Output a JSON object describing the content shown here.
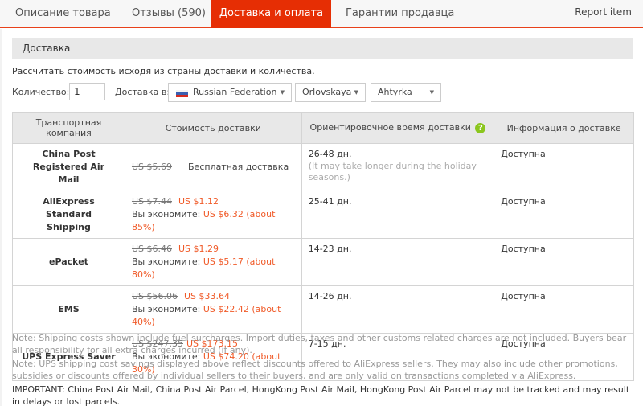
{
  "tabs": [
    {
      "label": "Описание товара",
      "active": false
    },
    {
      "label": "Отзывы (590)",
      "active": false
    },
    {
      "label": "Доставка и оплата",
      "active": true
    },
    {
      "label": "Гарантии продавца",
      "active": false
    }
  ],
  "report_link": "Report item",
  "section_title": "Доставка",
  "calc_text": "Рассчитать стоимость исходя из страны доставки и количества.",
  "form": {
    "quantity_label": "Количество:",
    "quantity_value": "1",
    "ship_to_label": "Доставка в:",
    "country": "Russian Federation",
    "region": "Orlovskaya",
    "city": "Ahtyrka"
  },
  "colors": {
    "accent": "#e62e04",
    "price": "#f05a28",
    "help": "#8bc61e"
  },
  "table": {
    "headers": [
      "Транспортная компания",
      "Стоимость доставки",
      "Ориентировочное время доставки",
      "Информация о доставке"
    ],
    "rows": [
      {
        "company": "China Post Registered Air Mail",
        "old_price": "US $5.69",
        "free": "Бесплатная доставка",
        "new_price": "",
        "save_label": "",
        "save_value": "",
        "time": "26-48 дн.",
        "time_note": "(It may take longer during the holiday seasons.)",
        "info": "Доступна"
      },
      {
        "company": "AliExpress Standard Shipping",
        "old_price": "US $7.44",
        "free": "",
        "new_price": "US $1.12",
        "save_label": "Вы экономите:",
        "save_value": "US $6.32 (about 85%)",
        "time": "25-41 дн.",
        "time_note": "",
        "info": "Доступна"
      },
      {
        "company": "ePacket",
        "old_price": "US $6.46",
        "free": "",
        "new_price": "US $1.29",
        "save_label": "Вы экономите:",
        "save_value": "US $5.17 (about 80%)",
        "time": "14-23 дн.",
        "time_note": "",
        "info": "Доступна"
      },
      {
        "company": "EMS",
        "old_price": "US $56.06",
        "free": "",
        "new_price": "US $33.64",
        "save_label": "Вы экономите:",
        "save_value": "US $22.42 (about 40%)",
        "time": "14-26 дн.",
        "time_note": "",
        "info": "Доступна"
      },
      {
        "company": "UPS Express Saver",
        "old_price": "US $247.35",
        "free": "",
        "new_price": "US $173.15",
        "save_label": "Вы экономите:",
        "save_value": "US $74.20 (about 30%)",
        "time": "7-15 дн.",
        "time_note": "",
        "info": "Доступна"
      }
    ]
  },
  "notes": [
    "Note: Shipping costs shown include fuel surcharges. Import duties, taxes and other customs related charges are not included. Buyers bear all responsibility for all extra charges incurred (if any).",
    "Note: UPS shipping cost savings displayed above reflect discounts offered to AliExpress sellers. They may also include other promotions, subsidies or discounts offered by individual sellers to their buyers, and are only valid on transactions completed via AliExpress."
  ],
  "important": "IMPORTANT: China Post Air Mail, China Post Air Parcel, HongKong Post Air Mail, HongKong Post Air Parcel may not be tracked and may result in delays or lost parcels."
}
